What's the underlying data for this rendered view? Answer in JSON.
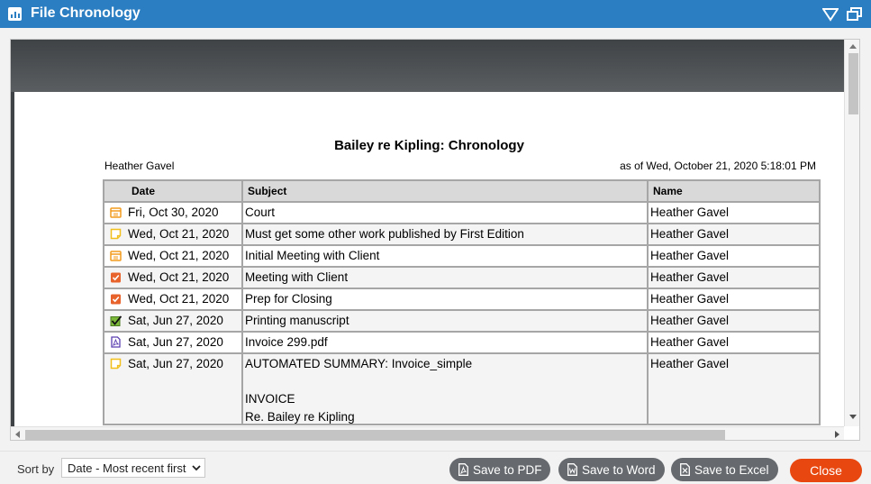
{
  "window": {
    "title": "File Chronology",
    "accent": "#2b7ec1"
  },
  "report": {
    "title": "Bailey re Kipling: Chronology",
    "user": "Heather Gavel",
    "as_of": "as of Wed, October 21, 2020  5:18:01 PM",
    "columns": [
      "Date",
      "Subject",
      "Name"
    ],
    "rows": [
      {
        "icon": "calendar-icon",
        "date": "Fri, Oct 30, 2020",
        "subject": "Court",
        "name": "Heather Gavel"
      },
      {
        "icon": "note-icon",
        "date": "Wed, Oct 21, 2020",
        "subject": "Must get some other work published by First Edition",
        "name": "Heather Gavel"
      },
      {
        "icon": "calendar-icon",
        "date": "Wed, Oct 21, 2020",
        "subject": "Initial Meeting with Client",
        "name": "Heather Gavel"
      },
      {
        "icon": "task-icon",
        "date": "Wed, Oct 21, 2020",
        "subject": "Meeting with Client",
        "name": "Heather Gavel"
      },
      {
        "icon": "task-icon",
        "date": "Wed, Oct 21, 2020",
        "subject": "Prep for Closing",
        "name": "Heather Gavel"
      },
      {
        "icon": "completed-task-icon",
        "date": "Sat, Jun 27, 2020",
        "subject": "Printing manuscript",
        "name": "Heather Gavel"
      },
      {
        "icon": "pdf-icon",
        "date": "Sat, Jun 27, 2020",
        "subject": "Invoice 299.pdf",
        "name": "Heather Gavel"
      },
      {
        "icon": "note-icon",
        "date": "Sat, Jun 27, 2020",
        "subject": "AUTOMATED SUMMARY:  Invoice_simple",
        "subject_line2": "INVOICE",
        "subject_line3": "Re. Bailey re Kipling",
        "name": "Heather Gavel"
      }
    ]
  },
  "footer": {
    "sort_label": "Sort by",
    "sort_value": "Date - Most recent first",
    "save_pdf": "Save to PDF",
    "save_word": "Save to Word",
    "save_excel": "Save to Excel",
    "close": "Close",
    "close_color": "#e8470f"
  }
}
